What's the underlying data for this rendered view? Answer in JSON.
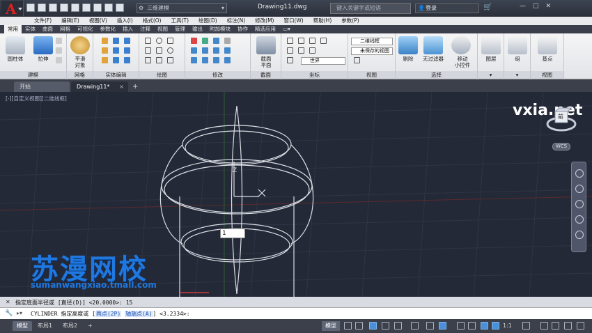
{
  "titlebar": {
    "app_logo": "A",
    "workspace": "三维建模",
    "document_title": "Drawing11.dwg",
    "search_placeholder": "键入关键字或短语",
    "login_label": "登录",
    "window_buttons": [
      "—",
      "□",
      "✕"
    ]
  },
  "menu": [
    "文件(F)",
    "编辑(E)",
    "视图(V)",
    "插入(I)",
    "格式(O)",
    "工具(T)",
    "绘图(D)",
    "标注(N)",
    "修改(M)",
    "窗口(W)",
    "帮助(H)",
    "参数(P)"
  ],
  "ribbon_tabs": [
    "常用",
    "实体",
    "曲面",
    "网格",
    "可视化",
    "参数化",
    "插入",
    "注释",
    "视图",
    "管理",
    "输出",
    "附加模块",
    "协作",
    "精选应用"
  ],
  "active_ribbon_tab": "常用",
  "ribbon": {
    "modeling": {
      "label": "建模",
      "box_label": "圆柱体",
      "extrude_label": "拉伸"
    },
    "mesh": {
      "label": "网格",
      "smooth_label": "平滑\n对象"
    },
    "solid_edit": {
      "label": "实体编辑"
    },
    "draw": {
      "label": "绘图"
    },
    "modify": {
      "label": "修改"
    },
    "section": {
      "label": "截面",
      "plane_label": "截面\n平面"
    },
    "coords": {
      "label": "坐标",
      "ucs_value": "世界"
    },
    "view": {
      "label": "视图",
      "visual_style": "二维线框",
      "saved_view": "未保存的视图"
    },
    "select": {
      "label": "选择",
      "cull_label": "剔除",
      "nofilter_label": "无过滤器",
      "gizmo_label": "移动\n小控件"
    },
    "layers": {
      "label": "",
      "layer_label": "图层"
    },
    "group": {
      "label": "",
      "group_label": "组"
    },
    "views": {
      "label": "视图",
      "base_label": "基点"
    }
  },
  "file_tabs": [
    {
      "label": "开始",
      "active": false
    },
    {
      "label": "Drawing11*",
      "active": true
    }
  ],
  "canvas": {
    "view_label": "[-][自定义视图][二维线框]",
    "ucs_z": "Z",
    "input_value": "1",
    "watermark_cn": "苏漫网校",
    "watermark_url": "sumanwangxiao.tmall.com",
    "site_watermark": "vxia.net",
    "viewcube_face": "前",
    "wcs_label": "WCS"
  },
  "command": {
    "history": "指定底面半径或 [直径(D)] <20.0000>: 15",
    "prompt_prefix": "CYLINDER 指定高度或 [",
    "opt1": "两点(2P)",
    "opt2": "轴端点(A)",
    "prompt_suffix": "] <3.2334>:"
  },
  "status": {
    "layout_tabs": [
      "模型",
      "布局1",
      "布局2"
    ],
    "active_layout": "模型",
    "model_btn": "模型",
    "scale": "1:1"
  }
}
